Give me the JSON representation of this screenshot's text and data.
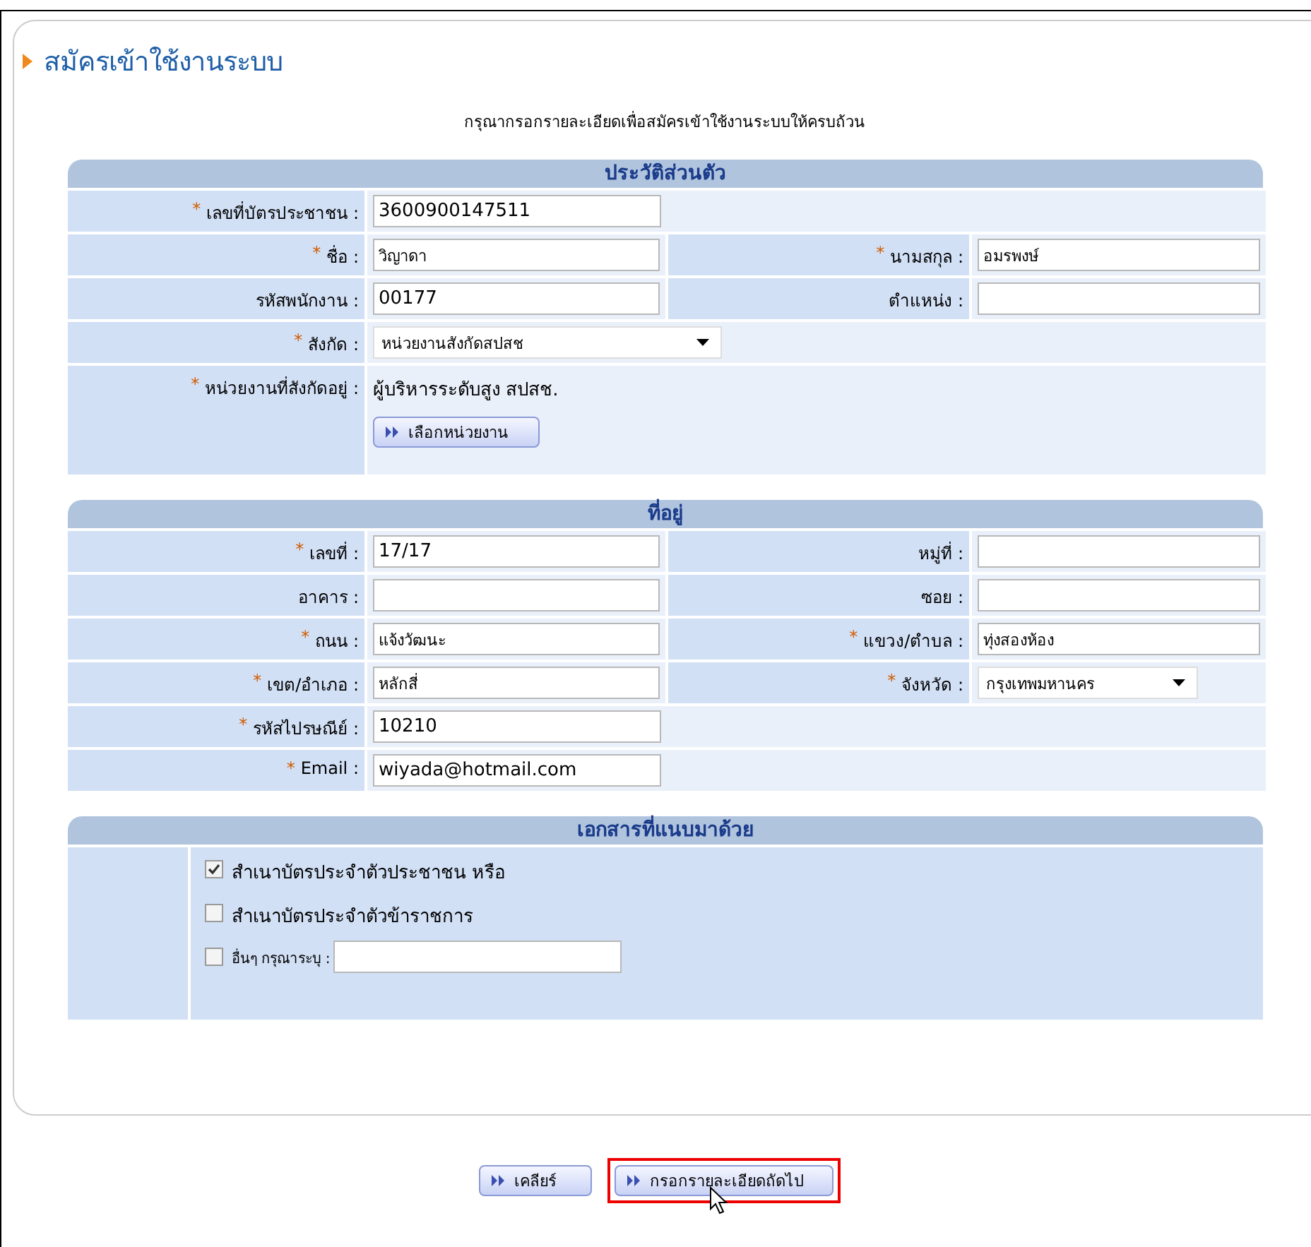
{
  "page": {
    "title": "สมัครเข้าใช้งานระบบ",
    "instruction": "กรุณากรอกรายละเอียดเพื่อสมัครเข้าใช้งานระบบให้ครบถ้วน"
  },
  "sections": [
    {
      "title": "ประวัติส่วนตัว",
      "rows": [
        {
          "fields": [
            {
              "label": "เลขที่บัตรประชาชน :",
              "required_mark": "*",
              "kind": "text",
              "value": "3600900147511"
            }
          ]
        },
        {
          "fields": [
            {
              "label": "ชื่อ :",
              "required_mark": "*",
              "kind": "text",
              "value": "วิญาดา"
            },
            {
              "label": "นามสกุล :",
              "required_mark": "*",
              "kind": "text",
              "value": "อมรพงษ์"
            }
          ]
        },
        {
          "fields": [
            {
              "label": "รหัสพนักงาน :",
              "kind": "text",
              "value": "00177"
            },
            {
              "label": "ตำแหน่ง :",
              "kind": "text"
            }
          ]
        },
        {
          "fields": [
            {
              "label": "สังกัด :",
              "required_mark": "*",
              "kind": "select",
              "value": "หน่วยงานสังกัดสปสช"
            }
          ]
        },
        {
          "fields": [
            {
              "label": "หน่วยงานที่สังกัดอยู่ :",
              "required_mark": "*",
              "kind": "static",
              "value": "ผู้บริหารระดับสูง สปสช.",
              "button": "เลือกหน่วยงาน"
            }
          ]
        }
      ]
    },
    {
      "title": "ที่อยู่",
      "rows": [
        {
          "fields": [
            {
              "label": "เลขที่ :",
              "required_mark": "*",
              "kind": "text",
              "value": "17/17"
            },
            {
              "label": "หมู่ที่ :",
              "kind": "text"
            }
          ]
        },
        {
          "fields": [
            {
              "label": "อาคาร :",
              "kind": "text"
            },
            {
              "label": "ซอย :",
              "kind": "text"
            }
          ]
        },
        {
          "fields": [
            {
              "label": "ถนน :",
              "required_mark": "*",
              "kind": "text",
              "value": "แจ้งวัฒนะ"
            },
            {
              "label": "แขวง/ตำบล :",
              "required_mark": "*",
              "kind": "text",
              "value": "ทุ่งสองห้อง"
            }
          ]
        },
        {
          "fields": [
            {
              "label": "เขต/อำเภอ :",
              "required_mark": "*",
              "kind": "text",
              "value": "หลักสี่"
            },
            {
              "label": "จังหวัด :",
              "required_mark": "*",
              "kind": "select",
              "value": "กรุงเทพมหานคร"
            }
          ]
        },
        {
          "fields": [
            {
              "label": "รหัสไปรษณีย์ :",
              "required_mark": "*",
              "kind": "text",
              "value": "10210"
            }
          ]
        },
        {
          "fields": [
            {
              "label": "Email :",
              "required_mark": "*",
              "kind": "text",
              "value": "wiyada@hotmail.com"
            }
          ]
        }
      ]
    }
  ],
  "documents": {
    "title": "เอกสารที่แนบมาด้วย",
    "items": [
      {
        "kind": "checkbox",
        "label": "สำเนาบัตรประจำตัวประชาชน หรือ",
        "checked": true
      },
      {
        "kind": "checkbox",
        "label": "สำเนาบัตรประจำตัวข้าราชการ",
        "checked": false
      },
      {
        "kind": "checkbox_input",
        "label": "อื่นๆ กรุณาระบุ :",
        "checked": false
      }
    ]
  },
  "buttons": [
    {
      "label": "เคลียร์",
      "highlighted": false
    },
    {
      "label": "กรอกรายละเอียดถัดไป",
      "highlighted": true
    }
  ]
}
